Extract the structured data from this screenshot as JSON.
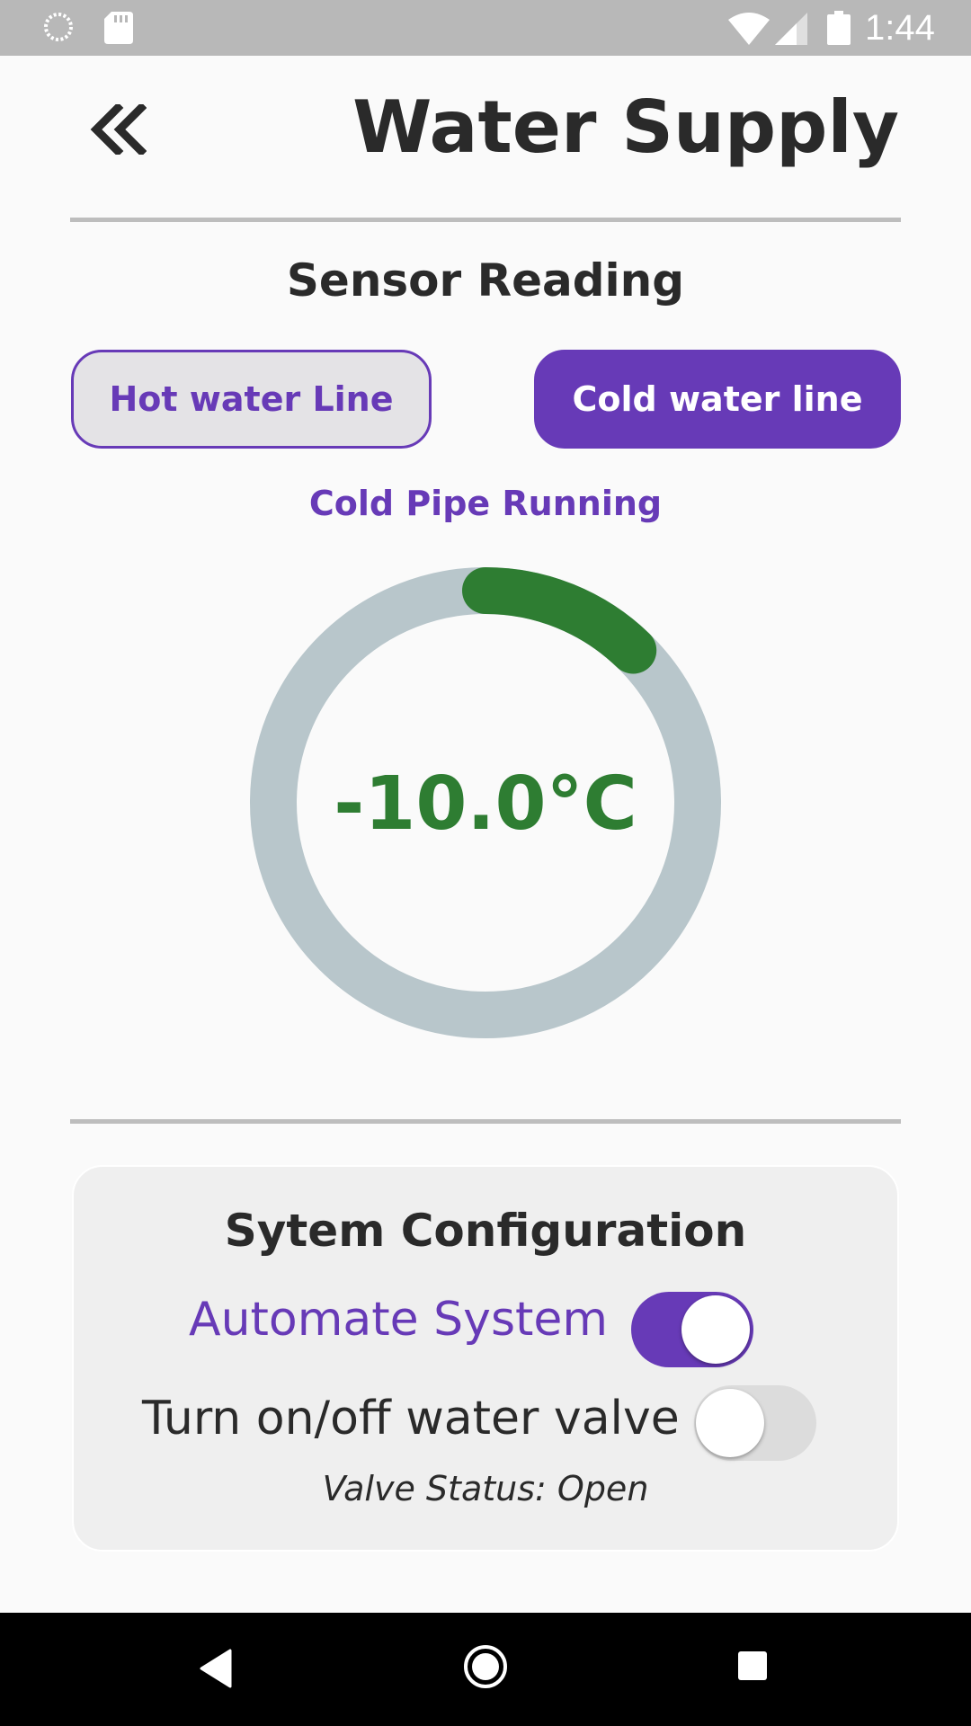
{
  "status_bar": {
    "time": "1:44",
    "icons": [
      "sync-icon",
      "sd-card-icon",
      "wifi-icon",
      "signal-icon",
      "battery-icon"
    ]
  },
  "header": {
    "back_icon": "double-chevron-left-icon",
    "title": "Water Supply"
  },
  "sensor": {
    "section_title": "Sensor Reading",
    "hot_line_label": "Hot water Line",
    "cold_line_label": "Cold water line",
    "selected_line": "cold",
    "pipe_status": "Cold Pipe Running",
    "temperature": "-10.0°C"
  },
  "config": {
    "title": "Sytem Configuration",
    "automate_label": "Automate System",
    "automate_on": true,
    "valve_label": "Turn on/off water valve",
    "valve_on": false,
    "valve_status": "Valve Status: Open"
  },
  "nav_bar": {
    "icons": [
      "back-triangle-icon",
      "home-circle-icon",
      "recents-square-icon"
    ]
  },
  "colors": {
    "accent": "#673ab7",
    "gauge_progress": "#2e7d32",
    "gauge_track": "#b8c6cb",
    "status_bar": "#b8b8b8"
  }
}
